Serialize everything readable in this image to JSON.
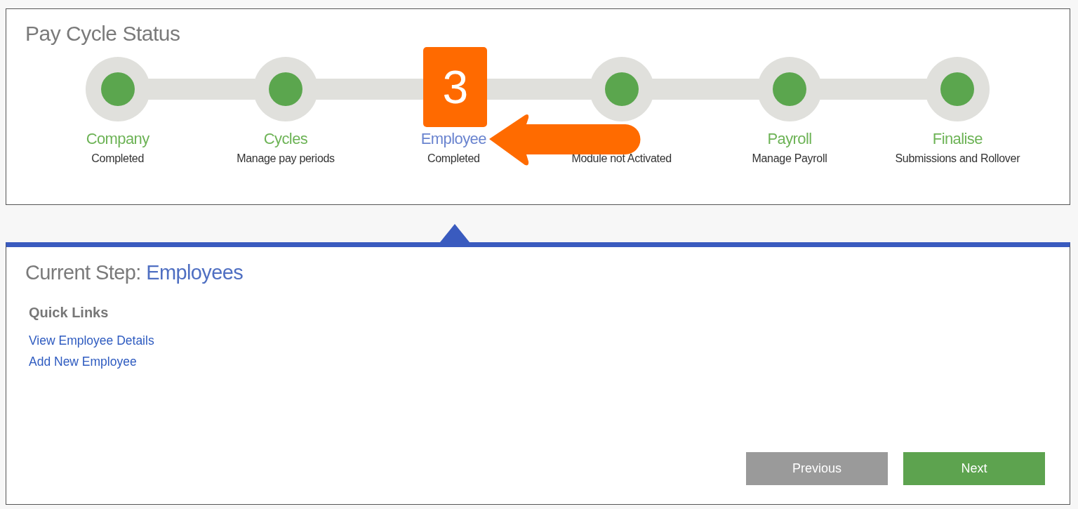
{
  "title": "Pay Cycle Status",
  "steps": [
    {
      "name": "Company",
      "status": "Completed",
      "selected": false
    },
    {
      "name": "Cycles",
      "status": "Manage pay periods",
      "selected": false
    },
    {
      "name": "Employee",
      "status": "Completed",
      "selected": true,
      "badge": "3"
    },
    {
      "status": "Module not Activated",
      "arrow": true
    },
    {
      "name": "Payroll",
      "status": "Manage Payroll",
      "selected": false
    },
    {
      "name": "Finalise",
      "status": "Submissions and Rollover",
      "selected": false
    }
  ],
  "current_step": {
    "label": "Current Step:",
    "value": "Employees"
  },
  "quick_links": {
    "heading": "Quick Links",
    "links": [
      "View Employee Details",
      "Add New Employee"
    ]
  },
  "buttons": [
    {
      "label": "Previous",
      "kind": "secondary"
    },
    {
      "label": "Next",
      "kind": "primary"
    }
  ]
}
